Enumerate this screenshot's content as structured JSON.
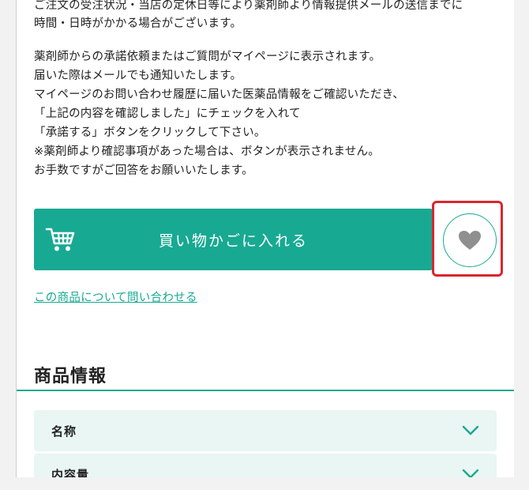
{
  "notice": {
    "cut_top_line": "ご注文の受注状況・当店の定休日等により薬剤師より情報提供メールの送信までに",
    "lines": [
      "時間・日時がかかる場合がございます。",
      "",
      "薬剤師からの承諾依頼またはご質問がマイページに表示されます。",
      "届いた際はメールでも通知いたします。",
      "マイページのお問い合わせ履歴に届いた医薬品情報をご確認いただき、",
      "「上記の内容を確認しました」にチェックを入れて",
      "「承諾する」ボタンをクリックして下さい。",
      "※薬剤師より確認事項があった場合は、ボタンが表示されません。",
      "お手数ですがご回答をお願いいたします。"
    ]
  },
  "actions": {
    "add_to_cart_label": "買い物かごに入れる",
    "cart_icon": "shopping-cart-icon",
    "favorite_icon": "heart-icon"
  },
  "links": {
    "inquiry": "この商品について問い合わせる"
  },
  "product_info": {
    "title": "商品情報",
    "sections": [
      {
        "label": "名称"
      },
      {
        "label": "内容量"
      }
    ]
  },
  "colors": {
    "accent": "#18a992",
    "highlight_border": "#d9262e",
    "accordion_bg": "#e9f6f3",
    "heart_gray": "#8f8f8f"
  }
}
